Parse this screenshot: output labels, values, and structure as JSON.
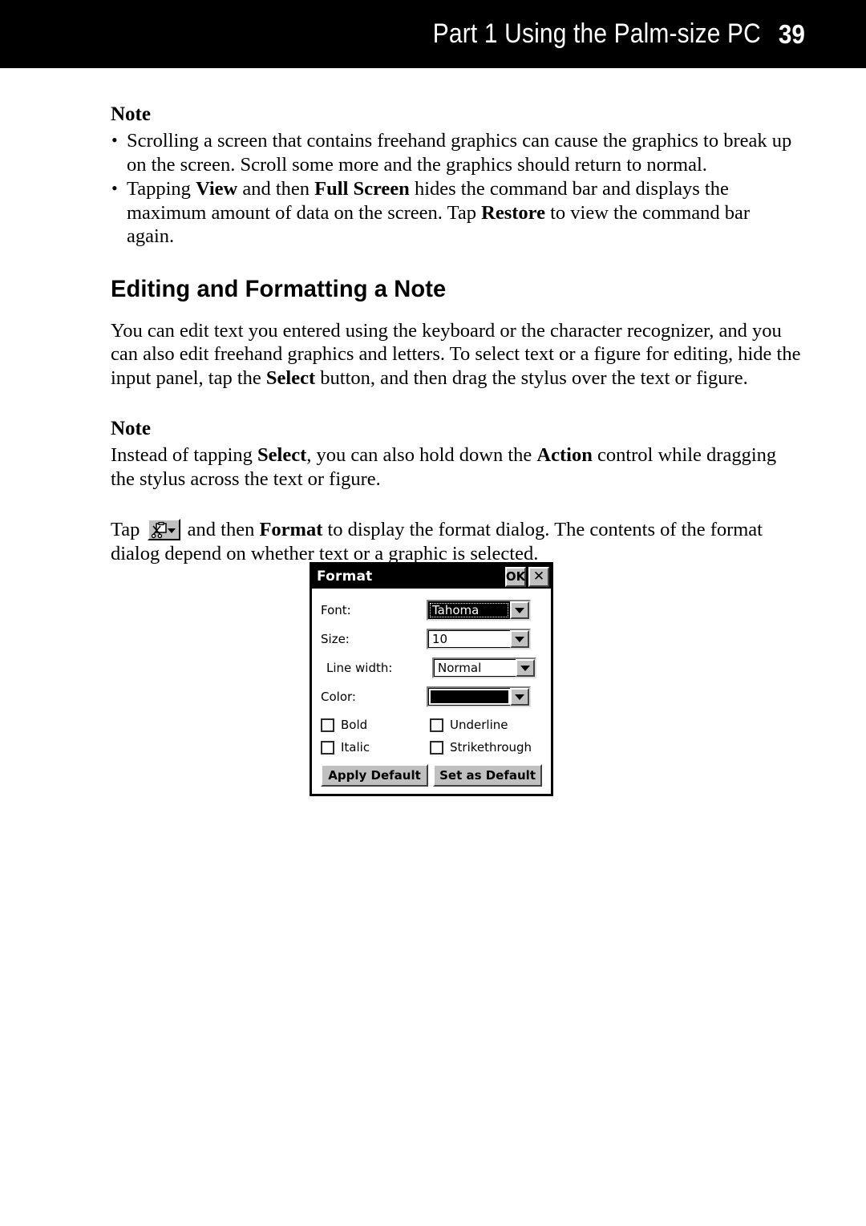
{
  "header": {
    "title": "Part 1  Using the Palm-size PC",
    "page_number": "39"
  },
  "note_top": {
    "label": "Note",
    "bullets": [
      {
        "text_before": "Scrolling a screen that contains freehand graphics can cause the graphics to break up on the screen. Scroll some more and the graphics should return to normal."
      },
      {
        "seg1": "Tapping ",
        "bold1": "View",
        "seg2": " and then ",
        "bold2": "Full Screen",
        "seg3": " hides the command bar and displays the maximum amount of data on the screen. Tap ",
        "bold3": "Restore",
        "seg4": " to view the command bar again."
      }
    ]
  },
  "section": {
    "heading": "Editing and Formatting a Note",
    "paragraph": {
      "seg1": "You can edit text you entered using the keyboard or the character recognizer, and you can also edit freehand graphics and letters. To select text or a figure for editing, hide the input panel, tap the ",
      "bold1": "Select",
      "seg2": " button, and then drag the stylus over the text or figure."
    }
  },
  "note_bottom": {
    "label": "Note",
    "paragraph": {
      "seg1": "Instead of tapping ",
      "bold1": "Select",
      "seg2": ", you can also hold down the ",
      "bold2": "Action",
      "seg3": " control while dragging the stylus across the text or figure."
    }
  },
  "tap_para": {
    "seg1": "Tap ",
    "icon_name": "edit-tools-toolbar-icon",
    "seg2": " and then ",
    "bold1": "Format",
    "seg3": " to display the format dialog. The contents of the format dialog depend on whether text or a graphic is selected."
  },
  "format_dialog": {
    "title": "Format",
    "ok_label": "OK",
    "close_label": "✕",
    "fields": [
      {
        "label": "Font:",
        "value": "Tahoma",
        "selected": true,
        "type": "combo"
      },
      {
        "label": "Size:",
        "value": "10",
        "selected": false,
        "type": "combo"
      },
      {
        "label": "Line width:",
        "value": "Normal",
        "selected": false,
        "type": "combo"
      },
      {
        "label": "Color:",
        "value": "",
        "selected": false,
        "type": "color",
        "swatch_color": "#000000"
      }
    ],
    "checkboxes": [
      {
        "label": "Bold",
        "checked": false
      },
      {
        "label": "Underline",
        "checked": false
      },
      {
        "label": "Italic",
        "checked": false
      },
      {
        "label": "Strikethrough",
        "checked": false
      }
    ],
    "buttons": {
      "apply": "Apply Default",
      "set_default": "Set as Default"
    }
  },
  "colors": {
    "header_bar": "#000000",
    "header_text": "#ffffff",
    "dialog_face": "#c0c0c0",
    "dialog_titlebar": "#000000",
    "selected_field_bg": "#000000",
    "page_background": "#ffffff"
  }
}
